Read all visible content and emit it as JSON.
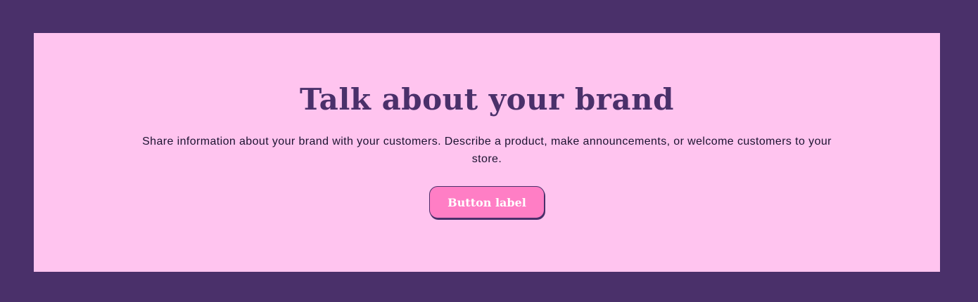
{
  "section": {
    "heading": "Talk about your brand",
    "description": "Share information about your brand with your customers. Describe a product, make announcements, or welcome customers to your store.",
    "button_label": "Button label"
  },
  "colors": {
    "outer_background": "#4a306a",
    "panel_background": "#ffc4ef",
    "heading": "#4a306a",
    "button_fill": "#ff7ec5",
    "button_text": "#ffffff",
    "body_text": "#1c1230"
  }
}
